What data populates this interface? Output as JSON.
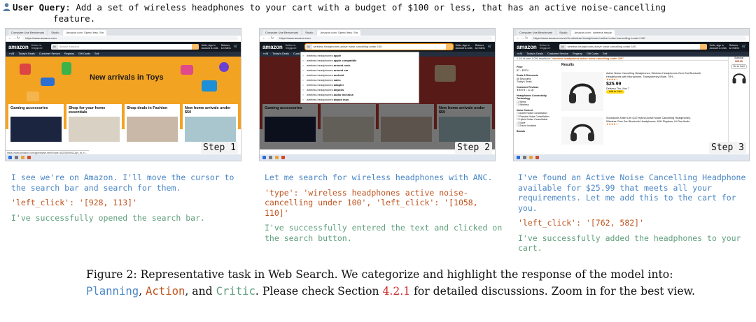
{
  "user_query": {
    "label": "User Query",
    "text_line1": ": Add a set of wireless headphones to your cart with a budget of $100 or less, that has an active noise-cancelling",
    "text_line2": "feature."
  },
  "screenshots": [
    {
      "step": "Step 1",
      "tabs": [
        "Computer Use Benchmark",
        "Studio",
        "Amazon.com. Spend less. Sm"
      ],
      "url": "https://www.amazon.com",
      "search_text": "Search Amazon",
      "hero_title": "New arrivals in Toys",
      "cards": [
        "Gaming accessories",
        "Shop for your home essentials",
        "Shop deals in Fashion",
        "New home arrivals under $50"
      ],
      "status_url": "https://www.amazon.com/gp/browse.html?node=16225009011&pf_rd_r=..."
    },
    {
      "step": "Step 2",
      "tabs": [
        "Computer Use Benchmark",
        "Studio",
        "Amazon.com. Spend less. Sm"
      ],
      "url": "https://www.amazon.com",
      "search_text": "wireless headphones active noise cancelling under 100",
      "suggestions_prefix": "wireless headphones",
      "suggestions": [
        "apple",
        "apple compatible",
        "around neck",
        "around ear",
        "android",
        "sales",
        "adapter",
        "airpods",
        "audio technica",
        "airpod max"
      ]
    },
    {
      "step": "Step 3",
      "tabs": [
        "Computer Use Benchmark",
        "Studio",
        "Amazon.com : wireless headp"
      ],
      "url": "https://www.amazon.com/s?k=wireless+headphones+active+noise+cancelling+under+100",
      "search_text": "wireless headphones active noise cancelling under 100",
      "results_count": "1-16 of over 1,000 results for",
      "results_query": "\"wireless headphones active noise cancelling under 100\"",
      "results_heading": "Results",
      "product1_title": "Active Noise Cancelling Headphones, Wireless Headphones Over Ear Bluetooth Headphones with Microphone, Transparency Mode, 70H...",
      "product1_price": "$25.99",
      "product1_button": "Add to Cart",
      "product2_title": "Soundcore Anker Life Q20 Hybrid Active Noise Cancelling Headphones, Wireless Over Ear Bluetooth Headphones, 60H Playtime, Hi-Res Audio",
      "cart_subtotal": "$25.99"
    }
  ],
  "columns": [
    {
      "planning": "I see we're on Amazon. I'll move the cursor to the search bar and search for them.",
      "action": "'left_click': '[928, 113]'",
      "critic": "I've successfully opened the search bar."
    },
    {
      "planning": "Let me search for wireless headphones with ANC.",
      "action": "'type': 'wireless headphones active noise-cancelling under 100', 'left_click': '[1058, 110]'",
      "critic": "I've successfully entered the text and clicked on the search button."
    },
    {
      "planning": "I've found an Active Noise Cancelling Headphone available for $25.99 that meets all your requirements. Let me add this to the cart for you.",
      "action": "'left_click': '[762, 582]'",
      "critic": "I've successfully added the headphones to your cart."
    }
  ],
  "caption": {
    "part1": "Figure 2: Representative task in Web Search. We categorize and highlight the response of the model into: ",
    "planning": "Planning",
    "sep1": ", ",
    "action": "Action",
    "sep2": ", and ",
    "critic": "Critic",
    "part2": ". Please check Section ",
    "ref": "4.2.1",
    "part3": " for detailed discussions. Zoom in for the best view."
  },
  "colors": {
    "planning": "#4a86c5",
    "action": "#c0541f",
    "critic": "#5f9e7c",
    "reference": "#d12a2a"
  },
  "icons": [
    "person-icon"
  ]
}
